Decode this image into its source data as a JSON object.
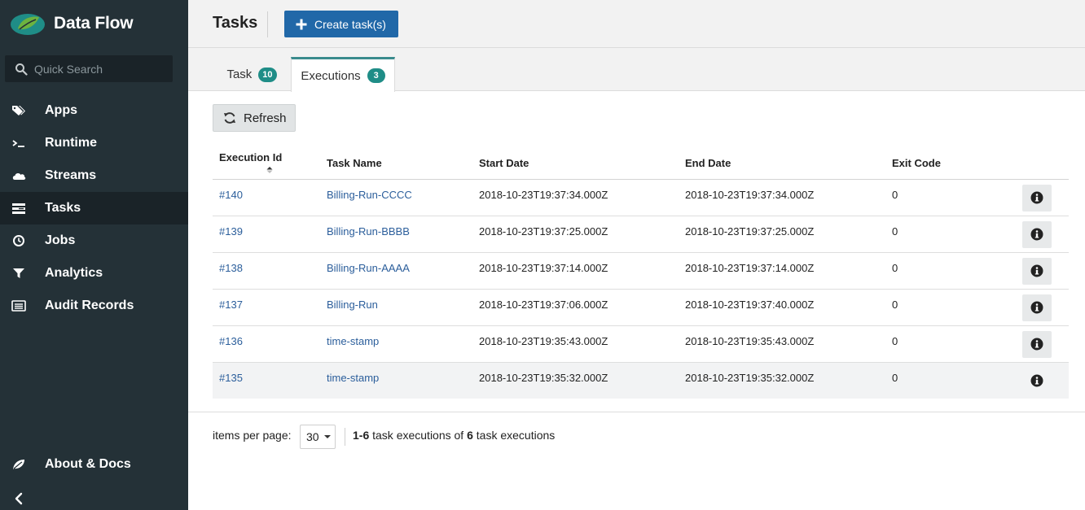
{
  "app": {
    "title": "Data Flow"
  },
  "search": {
    "placeholder": "Quick Search"
  },
  "sidebar": {
    "items": [
      {
        "label": "Apps",
        "icon": "tags-icon"
      },
      {
        "label": "Runtime",
        "icon": "terminal-icon"
      },
      {
        "label": "Streams",
        "icon": "cloud-icon"
      },
      {
        "label": "Tasks",
        "icon": "tasks-icon",
        "active": true
      },
      {
        "label": "Jobs",
        "icon": "clock-icon"
      },
      {
        "label": "Analytics",
        "icon": "filter-icon"
      },
      {
        "label": "Audit Records",
        "icon": "list-icon"
      }
    ],
    "about_label": "About & Docs"
  },
  "header": {
    "title": "Tasks",
    "create_label": "Create task(s)"
  },
  "tabs": [
    {
      "label": "Task",
      "count": "10",
      "active": false
    },
    {
      "label": "Executions",
      "count": "3",
      "active": true
    }
  ],
  "toolbar": {
    "refresh_label": "Refresh"
  },
  "table": {
    "headers": [
      "Execution Id",
      "Task Name",
      "Start Date",
      "End Date",
      "Exit Code"
    ],
    "rows": [
      {
        "id": "#140",
        "name": "Billing-Run-CCCC",
        "start": "2018-10-23T19:37:34.000Z",
        "end": "2018-10-23T19:37:34.000Z",
        "exit": "0"
      },
      {
        "id": "#139",
        "name": "Billing-Run-BBBB",
        "start": "2018-10-23T19:37:25.000Z",
        "end": "2018-10-23T19:37:25.000Z",
        "exit": "0"
      },
      {
        "id": "#138",
        "name": "Billing-Run-AAAA",
        "start": "2018-10-23T19:37:14.000Z",
        "end": "2018-10-23T19:37:14.000Z",
        "exit": "0"
      },
      {
        "id": "#137",
        "name": "Billing-Run",
        "start": "2018-10-23T19:37:06.000Z",
        "end": "2018-10-23T19:37:40.000Z",
        "exit": "0"
      },
      {
        "id": "#136",
        "name": "time-stamp",
        "start": "2018-10-23T19:35:43.000Z",
        "end": "2018-10-23T19:35:43.000Z",
        "exit": "0"
      },
      {
        "id": "#135",
        "name": "time-stamp",
        "start": "2018-10-23T19:35:32.000Z",
        "end": "2018-10-23T19:35:32.000Z",
        "exit": "0"
      }
    ]
  },
  "pagination": {
    "items_per_page_label": "items per page:",
    "items_per_page": "30",
    "range": "1-6",
    "middle_text": " task executions of ",
    "total": "6",
    "suffix_text": " task executions"
  },
  "colors": {
    "sidebar_bg": "#243137",
    "primary": "#2168a8",
    "badge": "#1f8d87",
    "link": "#2b5e9b"
  }
}
